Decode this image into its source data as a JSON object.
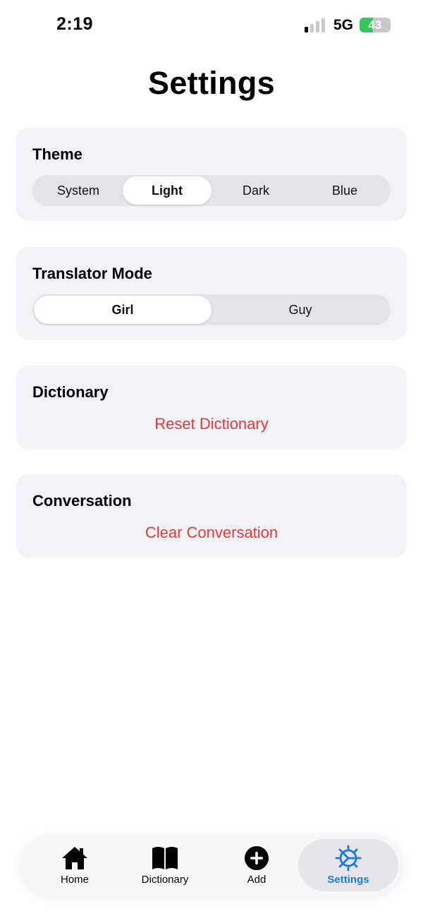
{
  "status_bar": {
    "time": "2:19",
    "network": "5G",
    "battery_level": "43",
    "signal_bars_active": 1,
    "signal_bars_total": 4
  },
  "header": {
    "title": "Settings"
  },
  "theme": {
    "title": "Theme",
    "options": [
      "System",
      "Light",
      "Dark",
      "Blue"
    ],
    "selected": "Light"
  },
  "translator_mode": {
    "title": "Translator Mode",
    "options": [
      "Girl",
      "Guy"
    ],
    "selected": "Girl"
  },
  "dictionary": {
    "title": "Dictionary",
    "action_label": "Reset Dictionary"
  },
  "conversation": {
    "title": "Conversation",
    "action_label": "Clear Conversation"
  },
  "tab_bar": {
    "items": [
      {
        "label": "Home",
        "icon": "house-icon"
      },
      {
        "label": "Dictionary",
        "icon": "book-icon"
      },
      {
        "label": "Add",
        "icon": "plus-circle-icon"
      },
      {
        "label": "Settings",
        "icon": "gear-icon"
      }
    ],
    "selected": "Settings"
  },
  "colors": {
    "card_background": "#f2f2f7",
    "segment_track": "#e3e3e8",
    "destructive": "#e5383b",
    "accent": "#1a7ae0",
    "battery_green": "#34c759"
  }
}
